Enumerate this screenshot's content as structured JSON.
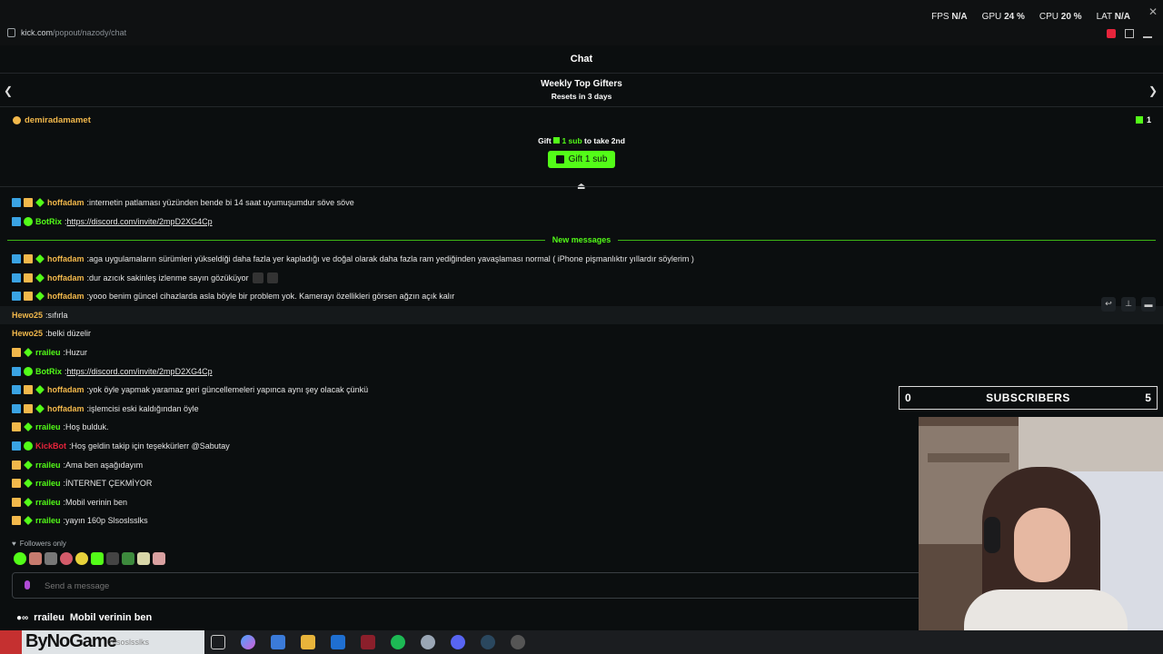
{
  "browser": {
    "url_host": "kick.com",
    "url_path": "/popout/nazody/chat"
  },
  "perf": {
    "fps_label": "FPS",
    "fps_value": "N/A",
    "gpu_label": "GPU",
    "gpu_value": "24 %",
    "cpu_label": "CPU",
    "cpu_value": "20 %",
    "lat_label": "LAT",
    "lat_value": "N/A"
  },
  "chat": {
    "title": "Chat",
    "gifters_title": "Weekly Top Gifters",
    "gifters_reset": "Resets in 3 days",
    "top_gifter_name": "demiradamamet",
    "top_gifter_count": "1",
    "gift_line_prefix": "Gift",
    "gift_line_sub": "1 sub",
    "gift_line_suffix": "to take 2nd",
    "gift_button": "Gift 1 sub",
    "new_messages": "New messages",
    "followers_only": "Followers only",
    "input_placeholder": "Send a message"
  },
  "messages_before": [
    {
      "user": "hoffadam",
      "color": "orange",
      "badges": [
        "mod",
        "crown",
        "star"
      ],
      "text": "internetin patlaması yüzünden bende bi 14 saat uyumuşumdur söve söve"
    },
    {
      "user": "BotRix",
      "color": "green",
      "badges": [
        "mod",
        "bot"
      ],
      "text": "https://discord.com/invite/2mpD2XG4Cp",
      "link": true
    }
  ],
  "messages_after": [
    {
      "user": "hoffadam",
      "color": "orange",
      "badges": [
        "mod",
        "crown",
        "star"
      ],
      "text": "aga uygulamaların sürümleri yükseldiği daha fazla yer kapladığı ve doğal olarak daha fazla ram yediğinden yavaşlaması normal ( iPhone pişmanlıktır yıllardır söylerim )"
    },
    {
      "user": "hoffadam",
      "color": "orange",
      "badges": [
        "mod",
        "crown",
        "star"
      ],
      "text": "dur azıcık sakinleş izlenme sayın gözüküyor",
      "emotes": 2
    },
    {
      "user": "hoffadam",
      "color": "orange",
      "badges": [
        "mod",
        "crown",
        "star"
      ],
      "text": "yooo benim güncel cihazlarda asla böyle bir problem yok. Kamerayı özellikleri görsen ağzın açık kalır"
    },
    {
      "user": "Hewo25",
      "color": "orange",
      "badges": [],
      "text": "sıfırla",
      "hover": true
    },
    {
      "user": "Hewo25",
      "color": "orange",
      "badges": [],
      "text": "belki düzelir"
    },
    {
      "user": "rraileu",
      "color": "green",
      "badges": [
        "crown",
        "star"
      ],
      "text": "Huzur"
    },
    {
      "user": "BotRix",
      "color": "green",
      "badges": [
        "mod",
        "bot"
      ],
      "text": "https://discord.com/invite/2mpD2XG4Cp",
      "link": true
    },
    {
      "user": "hoffadam",
      "color": "orange",
      "badges": [
        "mod",
        "crown",
        "star"
      ],
      "text": "yok öyle yapmak yaramaz geri güncellemeleri yapınca aynı şey olacak çünkü"
    },
    {
      "user": "hoffadam",
      "color": "orange",
      "badges": [
        "mod",
        "crown",
        "star"
      ],
      "text": "işlemcisi eski kaldığından öyle"
    },
    {
      "user": "rraileu",
      "color": "green",
      "badges": [
        "crown",
        "star"
      ],
      "text": "Hoş bulduk."
    },
    {
      "user": "KickBot",
      "color": "red",
      "badges": [
        "mod",
        "bot"
      ],
      "text": "Hoş geldin takip için teşekkürlerr @Sabutay"
    },
    {
      "user": "rraileu",
      "color": "green",
      "badges": [
        "crown",
        "star"
      ],
      "text": "Ama ben aşağıdayım"
    },
    {
      "user": "rraileu",
      "color": "green",
      "badges": [
        "crown",
        "star"
      ],
      "text": "İNTERNET ÇEKMİYOR"
    },
    {
      "user": "rraileu",
      "color": "green",
      "badges": [
        "crown",
        "star"
      ],
      "text": "Mobil verinin ben"
    },
    {
      "user": "rraileu",
      "color": "green",
      "badges": [
        "crown",
        "star"
      ],
      "text": "yayın 160p Slsoslsslks"
    }
  ],
  "subscribers": {
    "left": "0",
    "label": "SUBSCRIBERS",
    "right": "5"
  },
  "overlay": {
    "user": "rraileu",
    "text": "Mobil verinin ben"
  },
  "taskbar": {
    "brand": "ByNoGame",
    "ghost_text": "Slsoslsslks"
  },
  "colors": {
    "accent": "#53fc18",
    "user_orange": "#f2b84b",
    "user_red": "#e6243b",
    "mod_badge": "#3aa3e3"
  }
}
